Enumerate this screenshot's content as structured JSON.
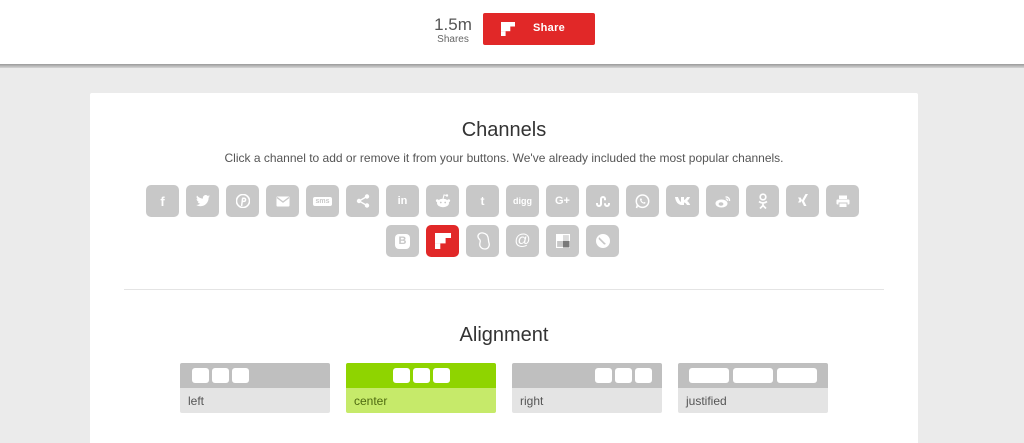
{
  "top": {
    "count_value": "1.5m",
    "count_label": "Shares",
    "share_label": "Share",
    "share_icon": "flipboard-icon",
    "accent": "#e12828"
  },
  "channels": {
    "title": "Channels",
    "description": "Click a channel to add or remove it from your buttons. We've already included the most popular channels.",
    "items": [
      {
        "name": "facebook",
        "glyph": "f",
        "selected": false
      },
      {
        "name": "twitter",
        "glyph": "",
        "selected": false
      },
      {
        "name": "pinterest",
        "glyph": "",
        "selected": false
      },
      {
        "name": "email",
        "glyph": "",
        "selected": false
      },
      {
        "name": "sms",
        "glyph": "sms",
        "selected": false
      },
      {
        "name": "sharethis",
        "glyph": "",
        "selected": false
      },
      {
        "name": "linkedin",
        "glyph": "in",
        "selected": false
      },
      {
        "name": "reddit",
        "glyph": "",
        "selected": false
      },
      {
        "name": "tumblr",
        "glyph": "t",
        "selected": false
      },
      {
        "name": "digg",
        "glyph": "digg",
        "selected": false
      },
      {
        "name": "googleplus",
        "glyph": "G+",
        "selected": false
      },
      {
        "name": "stumbleupon",
        "glyph": "",
        "selected": false
      },
      {
        "name": "whatsapp",
        "glyph": "",
        "selected": false
      },
      {
        "name": "vk",
        "glyph": "",
        "selected": false
      },
      {
        "name": "weibo",
        "glyph": "",
        "selected": false
      },
      {
        "name": "odnoklassniki",
        "glyph": "",
        "selected": false
      },
      {
        "name": "xing",
        "glyph": "",
        "selected": false
      },
      {
        "name": "print",
        "glyph": "",
        "selected": false
      },
      {
        "name": "blogger",
        "glyph": "B",
        "selected": false
      },
      {
        "name": "flipboard",
        "glyph": "",
        "selected": true
      },
      {
        "name": "meneame",
        "glyph": "",
        "selected": false
      },
      {
        "name": "mailru",
        "glyph": "@",
        "selected": false
      },
      {
        "name": "delicious",
        "glyph": "",
        "selected": false
      },
      {
        "name": "livejournal",
        "glyph": "",
        "selected": false
      }
    ]
  },
  "alignment": {
    "title": "Alignment",
    "options": [
      {
        "label": "left",
        "selected": false
      },
      {
        "label": "center",
        "selected": true
      },
      {
        "label": "right",
        "selected": false
      },
      {
        "label": "justified",
        "selected": false
      }
    ],
    "selected_color": "#8fd400"
  }
}
